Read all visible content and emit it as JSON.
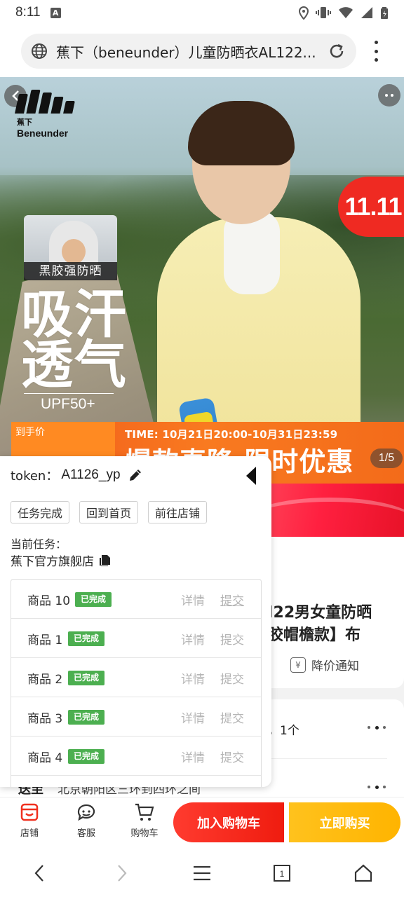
{
  "status_bar": {
    "time": "8:11",
    "notification_letter": "A"
  },
  "browser": {
    "url_text": "蕉下（beneunder）儿童防晒衣AL122...",
    "icons": [
      "globe-icon",
      "reload-icon",
      "overflow-menu-icon"
    ]
  },
  "hero": {
    "brand_top": "蕉下",
    "brand_name": "Beneunder",
    "badge_1111": "11.11",
    "inset_label": "黑胶强防晒",
    "headline_line1": "吸汗",
    "headline_line2": "透气",
    "upf": "UPF50+",
    "price_label": "到手价",
    "time_text": "TIME: 10月21日20:00-10月31日23:59",
    "slogan": "爆款直降 限时优惠",
    "page_indicator": "1/5"
  },
  "product": {
    "title_line1": "l22男女童防晒",
    "title_line2": "胶帽檐款】布",
    "price_notice": "降价通知",
    "spec_text": "，1个",
    "ship_label": "送至",
    "ship_text": "北京朝阳区三环到四环之间"
  },
  "bottom_bar": {
    "store_label": "店铺",
    "service_label": "客服",
    "cart_label": "购物车",
    "add_to_cart": "加入购物车",
    "buy_now": "立即购买"
  },
  "task_panel": {
    "token_label": "token：",
    "token_value": "A1126_yp",
    "buttons": [
      "任务完成",
      "回到首页",
      "前往店铺"
    ],
    "current_task_label": "当前任务：",
    "store_name": "蕉下官方旗舰店",
    "detail_label": "详情",
    "submit_label": "提交",
    "items": [
      {
        "name": "商品 10",
        "status": "已完成"
      },
      {
        "name": "商品 1",
        "status": "已完成"
      },
      {
        "name": "商品 2",
        "status": "已完成"
      },
      {
        "name": "商品 3",
        "status": "已完成"
      },
      {
        "name": "商品 4",
        "status": "已完成"
      }
    ]
  },
  "colors": {
    "accent_red": "#ef1c0f",
    "accent_yellow": "#ffb400",
    "complete_green": "#4caf50"
  }
}
